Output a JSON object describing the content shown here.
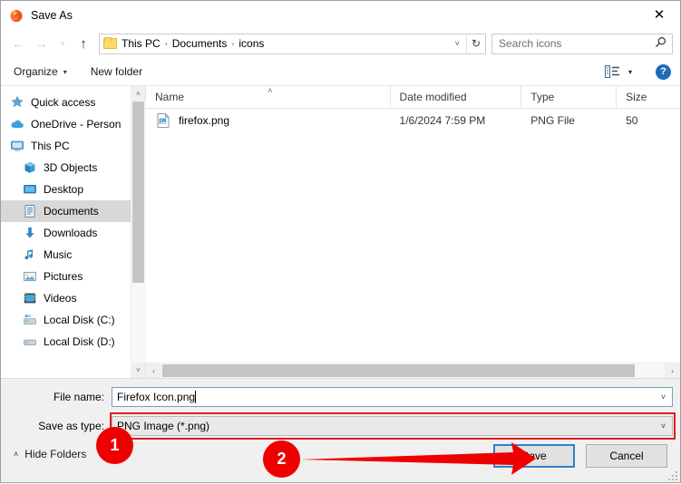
{
  "window": {
    "title": "Save As",
    "app_icon": "firefox-icon",
    "close_label": "✕"
  },
  "nav": {
    "back_icon": "←",
    "forward_icon": "→",
    "recent_icon": "˅",
    "up_icon": "↑",
    "breadcrumbs": [
      "This PC",
      "Documents",
      "icons"
    ],
    "separator": "›",
    "dropdown_icon": "˅",
    "refresh_icon": "↻"
  },
  "search": {
    "placeholder": "Search icons",
    "icon": "⚲"
  },
  "command_bar": {
    "organize_label": "Organize",
    "organize_caret": "▾",
    "new_folder_label": "New folder",
    "view_caret": "▾",
    "help_label": "?"
  },
  "sidebar": {
    "items": [
      {
        "label": "Quick access",
        "icon": "star-icon",
        "indent": false,
        "selected": false
      },
      {
        "label": "OneDrive - Person",
        "icon": "cloud-icon",
        "indent": false,
        "selected": false
      },
      {
        "label": "This PC",
        "icon": "monitor-icon",
        "indent": false,
        "selected": false
      },
      {
        "label": "3D Objects",
        "icon": "cube-icon",
        "indent": true,
        "selected": false
      },
      {
        "label": "Desktop",
        "icon": "desktop-icon",
        "indent": true,
        "selected": false
      },
      {
        "label": "Documents",
        "icon": "documents-icon",
        "indent": true,
        "selected": true
      },
      {
        "label": "Downloads",
        "icon": "download-icon",
        "indent": true,
        "selected": false
      },
      {
        "label": "Music",
        "icon": "music-icon",
        "indent": true,
        "selected": false
      },
      {
        "label": "Pictures",
        "icon": "pictures-icon",
        "indent": true,
        "selected": false
      },
      {
        "label": "Videos",
        "icon": "videos-icon",
        "indent": true,
        "selected": false
      },
      {
        "label": "Local Disk (C:)",
        "icon": "disk-icon",
        "indent": true,
        "selected": false
      },
      {
        "label": "Local Disk (D:)",
        "icon": "disk-icon",
        "indent": true,
        "selected": false
      }
    ],
    "scroll_up_icon": "˄",
    "scroll_down_icon": "˅"
  },
  "file_list": {
    "columns": [
      "Name",
      "Date modified",
      "Type",
      "Size"
    ],
    "sort_caret": "˄",
    "rows": [
      {
        "name": "firefox.png",
        "date": "1/6/2024 7:59 PM",
        "type": "PNG File",
        "size": "50"
      }
    ],
    "hscroll_left_icon": "‹",
    "hscroll_right_icon": "›"
  },
  "form": {
    "file_name_label": "File name:",
    "file_name_value": "Firefox Icon.png",
    "save_as_type_label": "Save as type:",
    "save_as_type_value": "PNG Image (*.png)",
    "combo_arrow": "˅",
    "hide_folders_label": "Hide Folders",
    "hide_folders_caret": "˄",
    "save_label": "Save",
    "cancel_label": "Cancel"
  },
  "annotations": {
    "accent_color": "#ee0000",
    "markers": [
      {
        "label": "1"
      },
      {
        "label": "2"
      }
    ]
  }
}
